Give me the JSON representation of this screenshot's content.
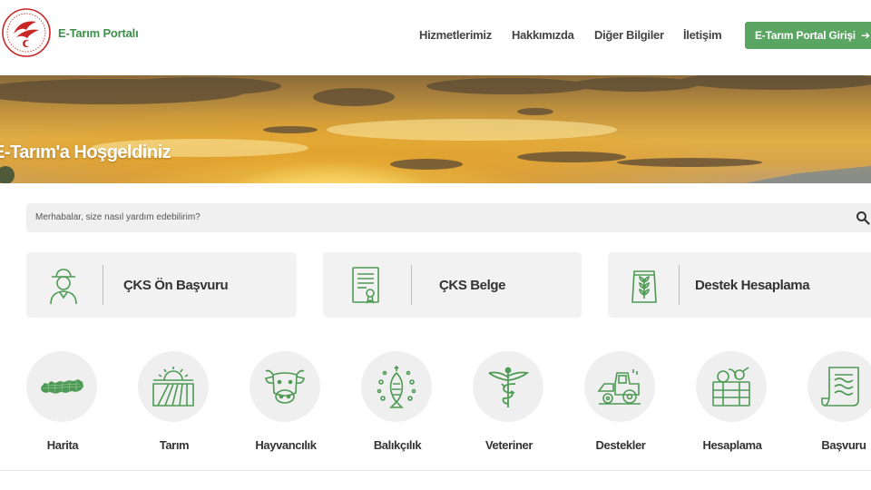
{
  "header": {
    "brand": "E-Tarım Portalı",
    "nav": {
      "services": "Hizmetlerimiz",
      "about": "Hakkımızda",
      "other_info": "Diğer Bilgiler",
      "contact": "İletişim"
    },
    "login_label": "E-Tarım Portal Girişi",
    "login_arrow": "➔"
  },
  "hero": {
    "title": "E-Tarım'a Hoşgeldiniz"
  },
  "search": {
    "placeholder": "Merhabalar, size nasıl yardım edebilirim?"
  },
  "cards": [
    {
      "label": "ÇKS Ön Başvuru",
      "icon": "farmer-icon"
    },
    {
      "label": "ÇKS Belge",
      "icon": "certificate-icon"
    },
    {
      "label": "Destek Hesaplama",
      "icon": "wheat-sack-icon"
    }
  ],
  "services": [
    {
      "label": "Harita",
      "icon": "turkey-map-icon"
    },
    {
      "label": "Tarım",
      "icon": "farm-field-icon"
    },
    {
      "label": "Hayvancılık",
      "icon": "cow-icon"
    },
    {
      "label": "Balıkçılık",
      "icon": "fish-icon"
    },
    {
      "label": "Veteriner",
      "icon": "caduceus-icon"
    },
    {
      "label": "Destekler",
      "icon": "tractor-icon"
    },
    {
      "label": "Hesaplama",
      "icon": "harvest-crate-icon"
    },
    {
      "label": "Başvuru",
      "icon": "document-scroll-icon"
    }
  ],
  "colors": {
    "brand_green": "#5aa562",
    "icon_green": "#4e9a55",
    "text_dark": "#333333",
    "card_bg": "#f2f2f2"
  }
}
